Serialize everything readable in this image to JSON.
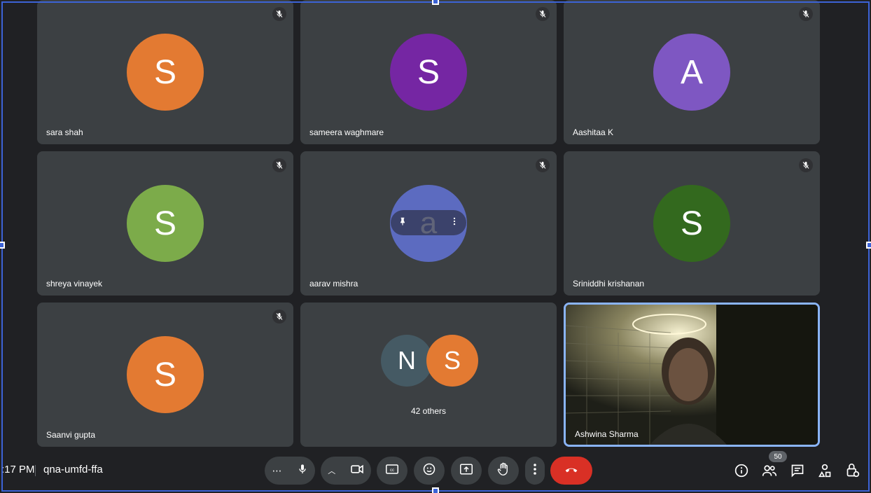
{
  "participants": [
    {
      "initial": "S",
      "name": "sara shah",
      "color": "#e37a32"
    },
    {
      "initial": "S",
      "name": "sameera waghmare",
      "color": "#7526a3"
    },
    {
      "initial": "A",
      "name": "Aashitaa K",
      "color": "#7e57c2"
    },
    {
      "initial": "S",
      "name": "shreya vinayek",
      "color": "#7cab4a"
    },
    {
      "initial": "a",
      "name": "aarav mishra",
      "color": "#5c6bc0"
    },
    {
      "initial": "S",
      "name": "Sriniddhi krishanan",
      "color": "#33691e"
    },
    {
      "initial": "S",
      "name": "Saanvi gupta",
      "color": "#e37a32"
    }
  ],
  "others": {
    "initials": [
      "N",
      "S"
    ],
    "colors": [
      "#455a64",
      "#e37a32"
    ],
    "label": "42 others"
  },
  "self_view": {
    "name": "Ashwina Sharma"
  },
  "meeting": {
    "time": ":17 PM",
    "code": "qna-umfd-ffa"
  },
  "people_count": "50",
  "colors": {
    "end_call": "#d93025",
    "active_border": "#8ab4f8",
    "tile": "#3c4043",
    "background": "#202124"
  }
}
